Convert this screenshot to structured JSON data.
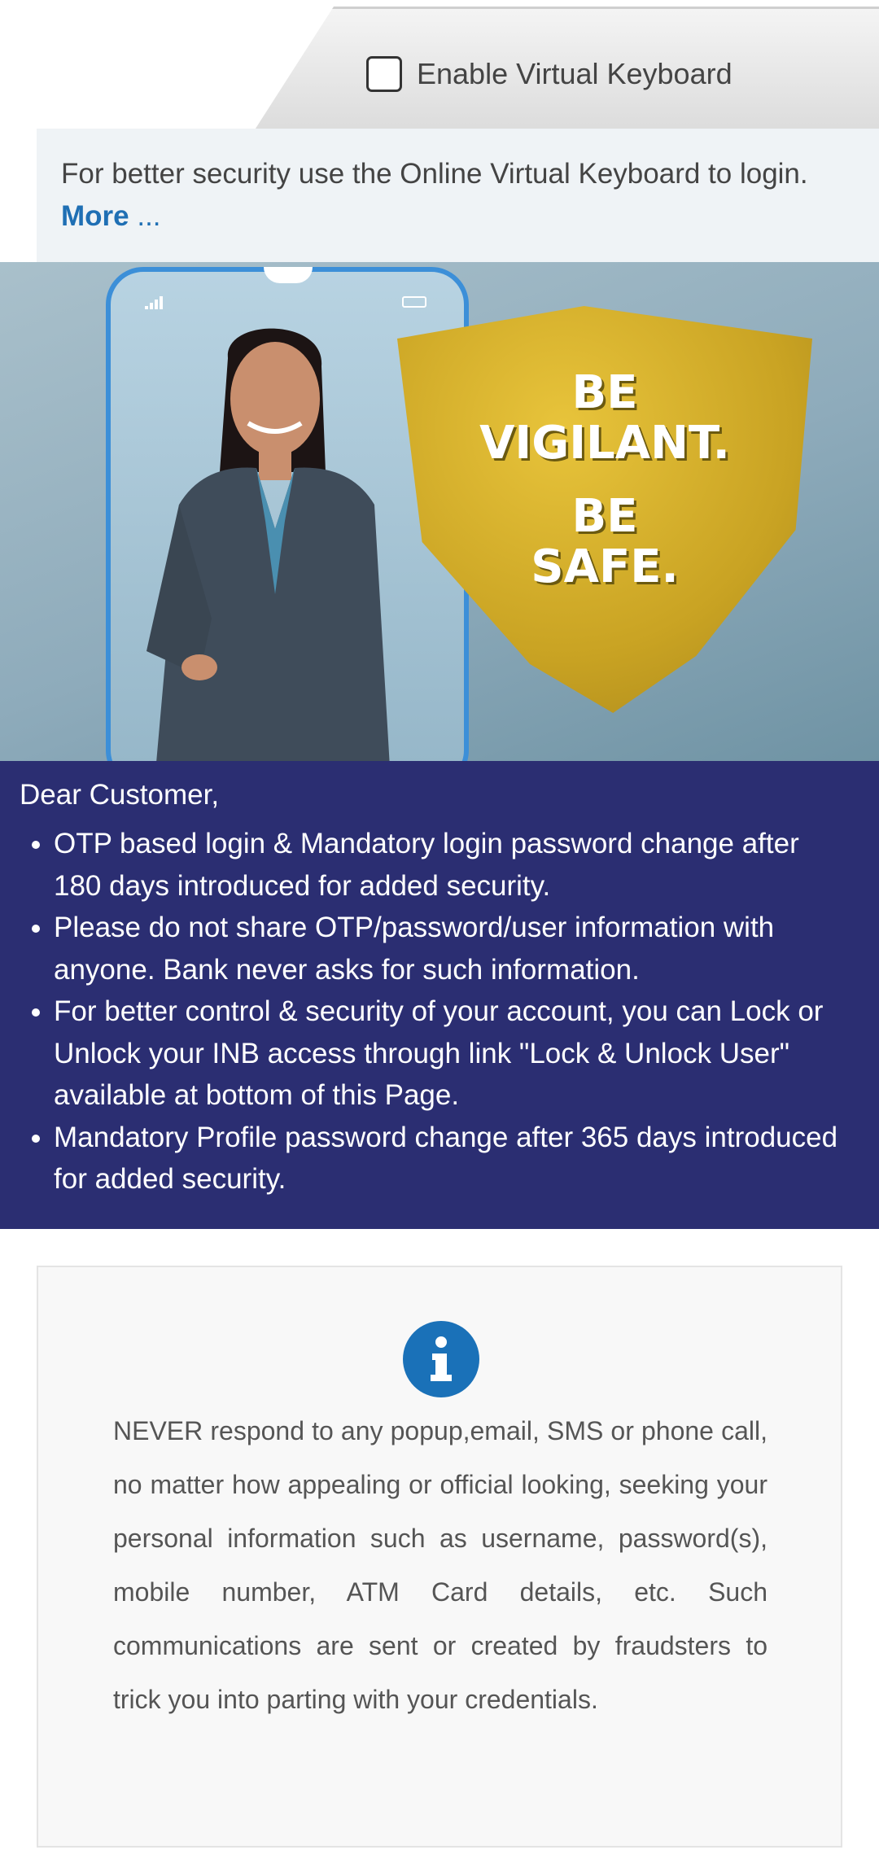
{
  "virtual_keyboard": {
    "checkbox_label": "Enable Virtual Keyboard",
    "checked": false,
    "note": "For better security use the Online Virtual Keyboard to login.",
    "more_link": "More",
    "more_dots": " ..."
  },
  "banner": {
    "line1": "BE",
    "line2": "VIGILANT.",
    "line3": "BE",
    "line4": "SAFE."
  },
  "notice": {
    "greeting": "Dear Customer,",
    "items": [
      "OTP based login & Mandatory login password change after 180 days introduced for added security.",
      "Please do not share OTP/password/user information with anyone. Bank never asks for such information.",
      "For better control & security of your account, you can Lock or Unlock your INB access through link \"Lock & Unlock User\" available at bottom of this Page.",
      "Mandatory Profile password change after 365 days introduced for added security."
    ]
  },
  "warning": {
    "icon": "info-icon",
    "text": "NEVER respond to any popup,email, SMS or phone call, no matter how appealing or official looking, seeking your personal information such as username, password(s), mobile number, ATM Card details, etc. Such communications are sent or created by fraudsters to trick you into parting with your credentials."
  },
  "colors": {
    "notice_bg": "#2b2e72",
    "link": "#1f6fb4",
    "info_icon": "#1a71b8",
    "shield": "#c9a323"
  }
}
